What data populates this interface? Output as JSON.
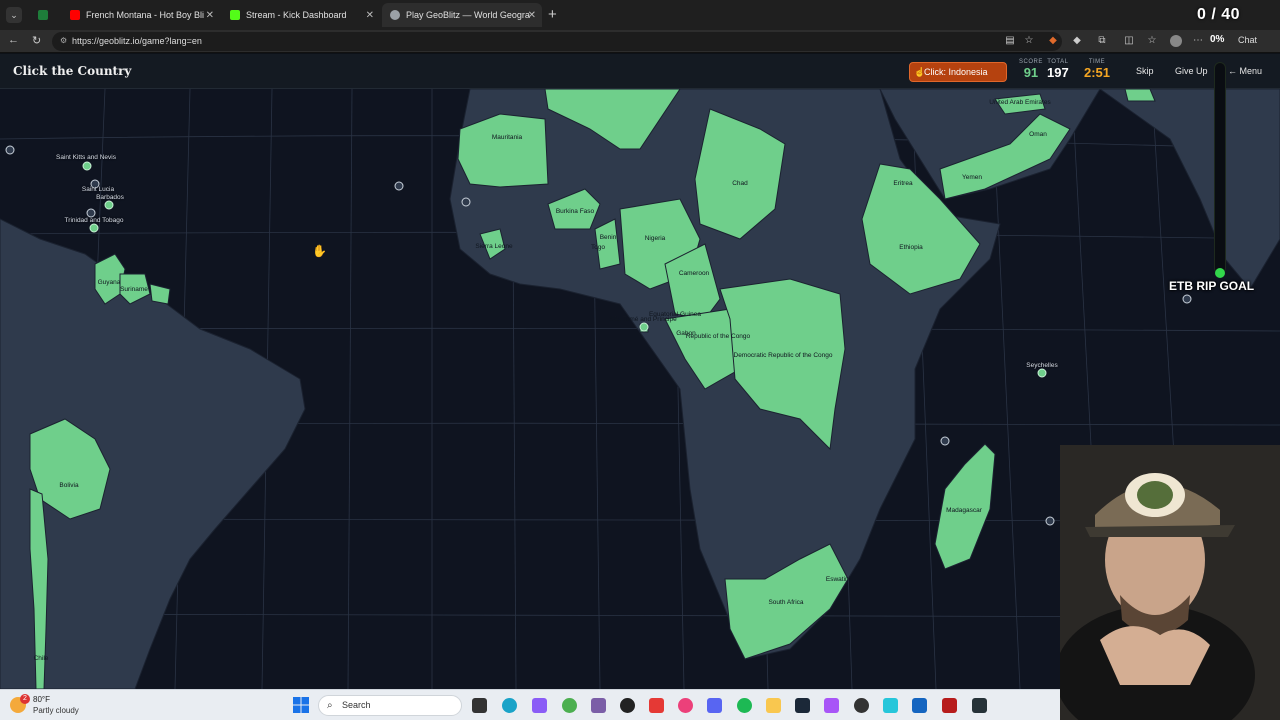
{
  "browser": {
    "tabs": [
      {
        "label": "French Montana - Hot Boy Bling ft",
        "color": "#ff0000"
      },
      {
        "label": "Stream - Kick Dashboard",
        "color": "#53fc18"
      },
      {
        "label": "Play GeoBlitz — World Geography",
        "color": "#9aa0a6"
      }
    ],
    "url": "https://geoblitz.io/game?lang=en",
    "percent_badge": "0%",
    "chat_label": "Chat"
  },
  "stream": {
    "counter": "0 / 40",
    "goal_label": "ETB RIP GOAL"
  },
  "game": {
    "title": "Click the Country",
    "prompt": "Click: Indonesia",
    "score_label": "SCORE",
    "score": "91",
    "total_label": "TOTAL",
    "total": "197",
    "time_label": "TIME",
    "time": "2:51",
    "skip": "Skip",
    "give_up": "Give Up",
    "menu": "Menu"
  },
  "countries": {
    "mauritania": "Mauritania",
    "chad": "Chad",
    "eritrea": "Eritrea",
    "uae": "United Arab Emirates",
    "oman": "Oman",
    "yemen": "Yemen",
    "burkina": "Burkina Faso",
    "benin": "Benin",
    "togo": "Togo",
    "nigeria": "Nigeria",
    "ethiopia": "Ethiopia",
    "sierra": "Sierra Leone",
    "cameroon": "Cameroon",
    "eq_guinea": "Equatorial Guinea",
    "sao_tome": "São Tomé and Príncipe",
    "gabon": "Gabon",
    "congo": "Republic of the Congo",
    "drc": "Democratic Republic of the Congo",
    "seychelles": "Seychelles",
    "madagascar": "Madagascar",
    "eswatini": "Eswatini",
    "south_africa": "South Africa",
    "guyana": "Guyana",
    "suriname": "Suriname",
    "bolivia": "Bolivia",
    "chile": "Chile",
    "st_kitts": "Saint Kitts and Nevis",
    "st_lucia": "Saint Lucia",
    "barbados": "Barbados",
    "trinidad": "Trinidad and Tobago"
  },
  "taskbar": {
    "temp": "80°F",
    "weather": "Partly cloudy",
    "weather_badge": "2",
    "search_placeholder": "Search"
  },
  "colors": {
    "found": "#6fcf8b",
    "land": "#2f3a4c",
    "ocean": "#0f1420",
    "prompt": "#b5420f",
    "score": "#6fcf8b",
    "time": "#f5a623"
  }
}
